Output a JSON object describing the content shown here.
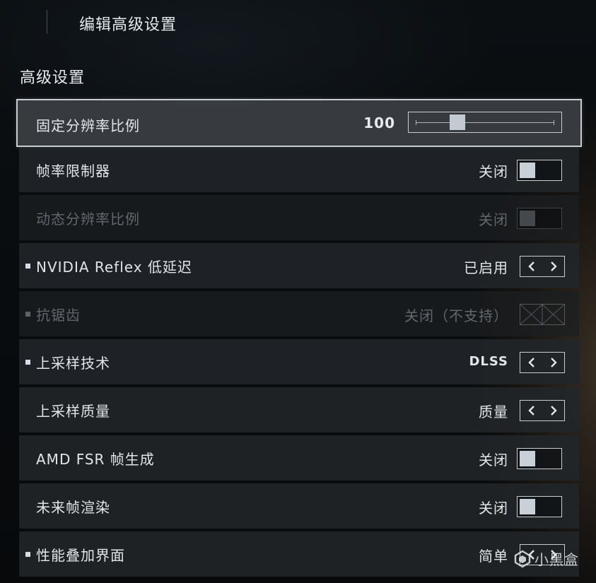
{
  "header": {
    "title": "编辑高级设置"
  },
  "section": {
    "title": "高级设置"
  },
  "settings": [
    {
      "label": "固定分辨率比例",
      "value": "100",
      "control": "slider",
      "slider_fraction": 0.3
    },
    {
      "label": "帧率限制器",
      "value": "关闭",
      "control": "toggle"
    },
    {
      "label": "动态分辨率比例",
      "value": "关闭",
      "control": "toggle",
      "disabled": true
    },
    {
      "label": "NVIDIA Reflex 低延迟",
      "value": "已启用",
      "control": "stepper",
      "bullet": true
    },
    {
      "label": "抗锯齿",
      "value": "关闭（不支持）",
      "control": "unavailable",
      "bullet": true,
      "disabled": true
    },
    {
      "label": "上采样技术",
      "value": "DLSS",
      "control": "stepper",
      "bullet": true
    },
    {
      "label": "上采样质量",
      "value": "质量",
      "control": "stepper"
    },
    {
      "label": "AMD FSR 帧生成",
      "value": "关闭",
      "control": "toggle"
    },
    {
      "label": "未来帧渲染",
      "value": "关闭",
      "control": "toggle"
    },
    {
      "label": "性能叠加界面",
      "value": "简单",
      "control": "stepper",
      "bullet": true
    }
  ],
  "watermark": {
    "text": "小黑盒",
    "icon": "xiaoheihe-logo-icon"
  },
  "colors": {
    "row_bg": "#22262a",
    "selected_border": "#c9ced3",
    "text": "#e3e6e9",
    "disabled_text": "#62676c"
  }
}
